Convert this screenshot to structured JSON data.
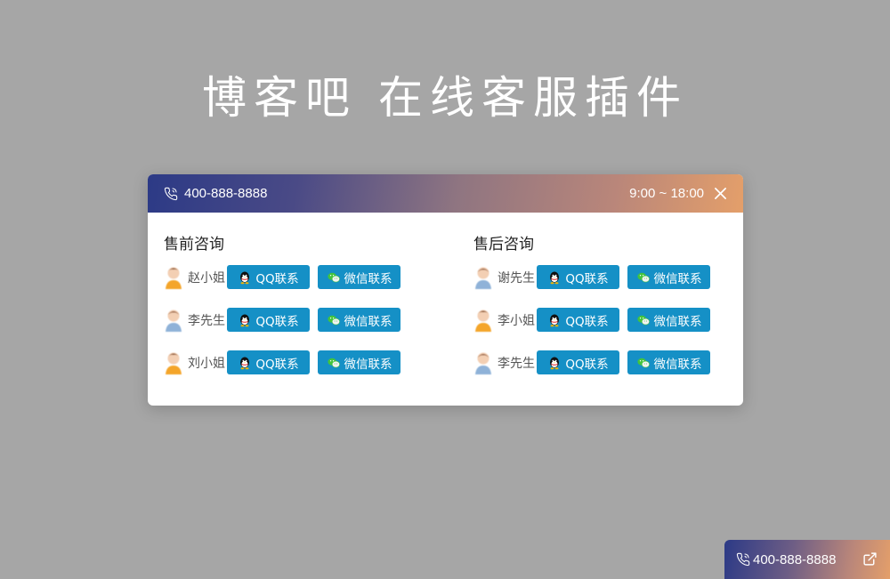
{
  "page_title": "博客吧 在线客服插件",
  "header": {
    "phone": "400-888-8888",
    "hours": "9:00 ~ 18:00",
    "phone_icon": "phone-icon",
    "close_icon": "close-icon"
  },
  "sections": [
    {
      "title": "售前咨询",
      "agents": [
        {
          "name": "赵小姐",
          "gender": "female",
          "qq_label": "QQ联系",
          "wx_label": "微信联系"
        },
        {
          "name": "李先生",
          "gender": "male",
          "qq_label": "QQ联系",
          "wx_label": "微信联系"
        },
        {
          "name": "刘小姐",
          "gender": "female",
          "qq_label": "QQ联系",
          "wx_label": "微信联系"
        }
      ]
    },
    {
      "title": "售后咨询",
      "agents": [
        {
          "name": "谢先生",
          "gender": "male",
          "qq_label": "QQ联系",
          "wx_label": "微信联系"
        },
        {
          "name": "李小姐",
          "gender": "female",
          "qq_label": "QQ联系",
          "wx_label": "微信联系"
        },
        {
          "name": "李先生",
          "gender": "male",
          "qq_label": "QQ联系",
          "wx_label": "微信联系"
        }
      ]
    }
  ],
  "float_bar": {
    "phone": "400-888-8888",
    "phone_icon": "phone-icon",
    "open_icon": "external-link-icon"
  },
  "colors": {
    "button": "#1590c6",
    "background": "#a6a6a6",
    "gradient_start": "#2c3a86",
    "gradient_end": "#e49f6a"
  }
}
